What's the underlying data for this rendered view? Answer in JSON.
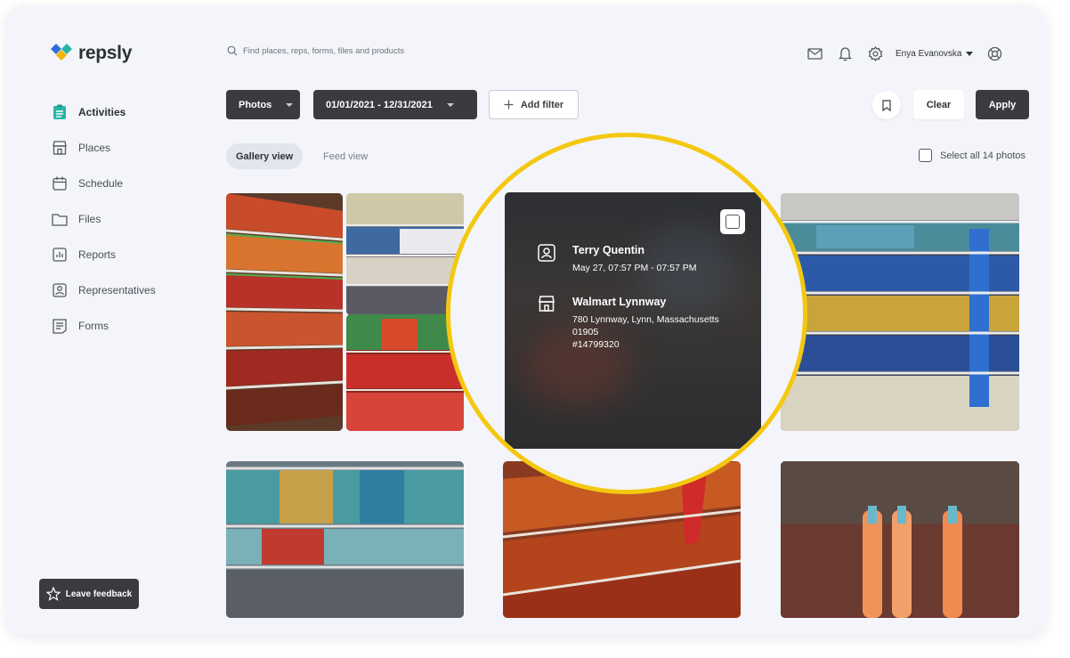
{
  "brand": {
    "name": "repsly"
  },
  "sidebar": {
    "items": [
      {
        "label": "Activities",
        "icon": "clipboard-icon",
        "active": true
      },
      {
        "label": "Places",
        "icon": "store-icon"
      },
      {
        "label": "Schedule",
        "icon": "calendar-icon"
      },
      {
        "label": "Files",
        "icon": "folder-icon"
      },
      {
        "label": "Reports",
        "icon": "bar-chart-icon"
      },
      {
        "label": "Representatives",
        "icon": "person-badge-icon"
      },
      {
        "label": "Forms",
        "icon": "form-icon"
      }
    ],
    "feedback_label": "Leave feedback"
  },
  "header": {
    "search_placeholder": "Find places, reps, forms, files and products",
    "user_name": "Enya Evanovska"
  },
  "filters": {
    "type_label": "Photos",
    "date_range": "01/01/2021 - 12/31/2021",
    "add_filter_label": "Add filter",
    "clear_label": "Clear",
    "apply_label": "Apply"
  },
  "views": {
    "gallery_label": "Gallery view",
    "feed_label": "Feed view",
    "select_all_label": "Select all 14 photos"
  },
  "highlight": {
    "rep_name": "Terry Quentin",
    "time": "May 27, 07:57 PM - 07:57 PM",
    "place_name": "Walmart Lynnway",
    "address_line1": "780 Lynnway, Lynn, Massachusetts",
    "address_line2": "01905",
    "place_id": "#14799320"
  },
  "colors": {
    "accent_yellow": "#f4c811",
    "brand_teal": "#27b5a4",
    "dark_button": "#3a3b3f"
  }
}
